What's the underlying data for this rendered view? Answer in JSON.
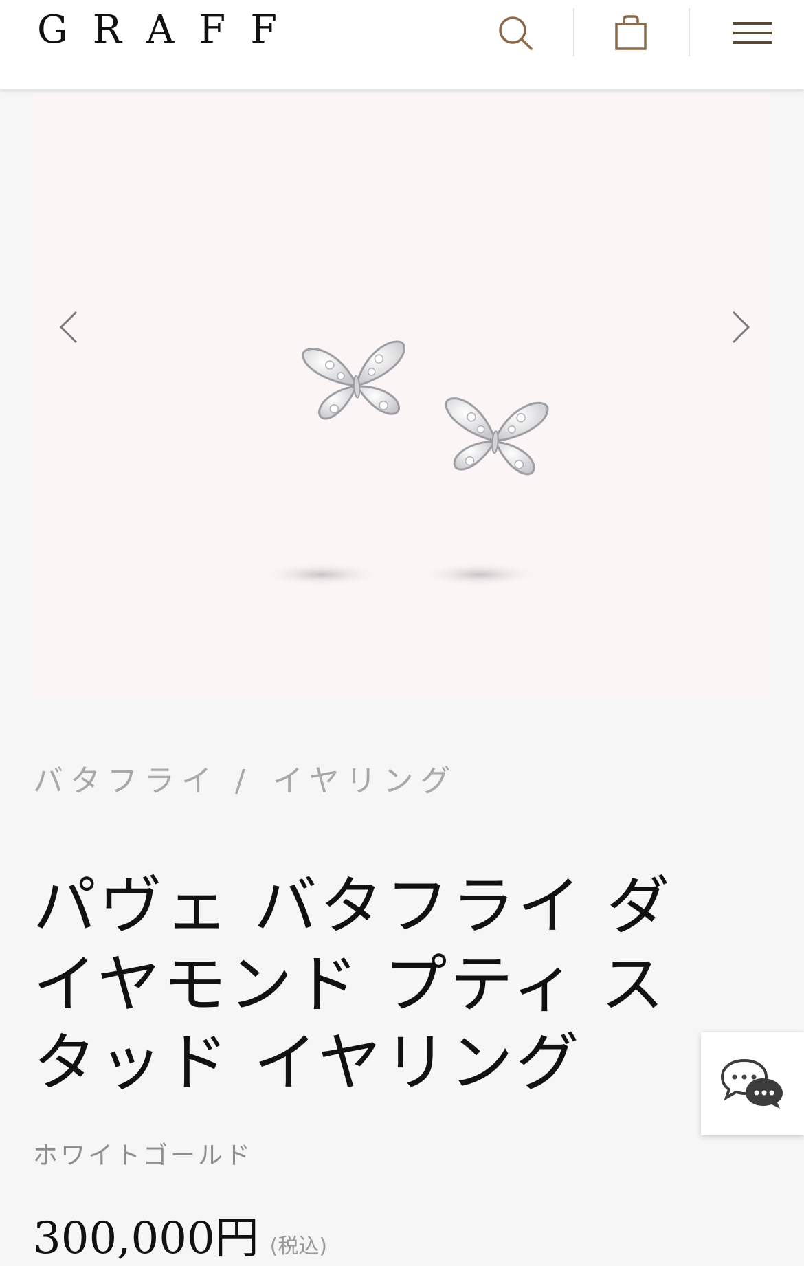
{
  "header": {
    "logo": "GRAFF",
    "search_icon": "search-icon",
    "bag_icon": "shopping-bag-icon",
    "menu_icon": "hamburger-menu-icon"
  },
  "gallery": {
    "prev_icon": "chevron-left-icon",
    "next_icon": "chevron-right-icon",
    "background": "#fcf5f6"
  },
  "breadcrumb": {
    "items": [
      "バタフライ",
      "イヤリング"
    ],
    "separator": "/"
  },
  "product": {
    "title": "パヴェ バタフライ ダイヤモンド プティ スタッド イヤリング",
    "material": "ホワイトゴールド",
    "price": "300,000円",
    "tax_note": "(税込)"
  },
  "chat": {
    "icon": "chat-bubbles-icon"
  }
}
